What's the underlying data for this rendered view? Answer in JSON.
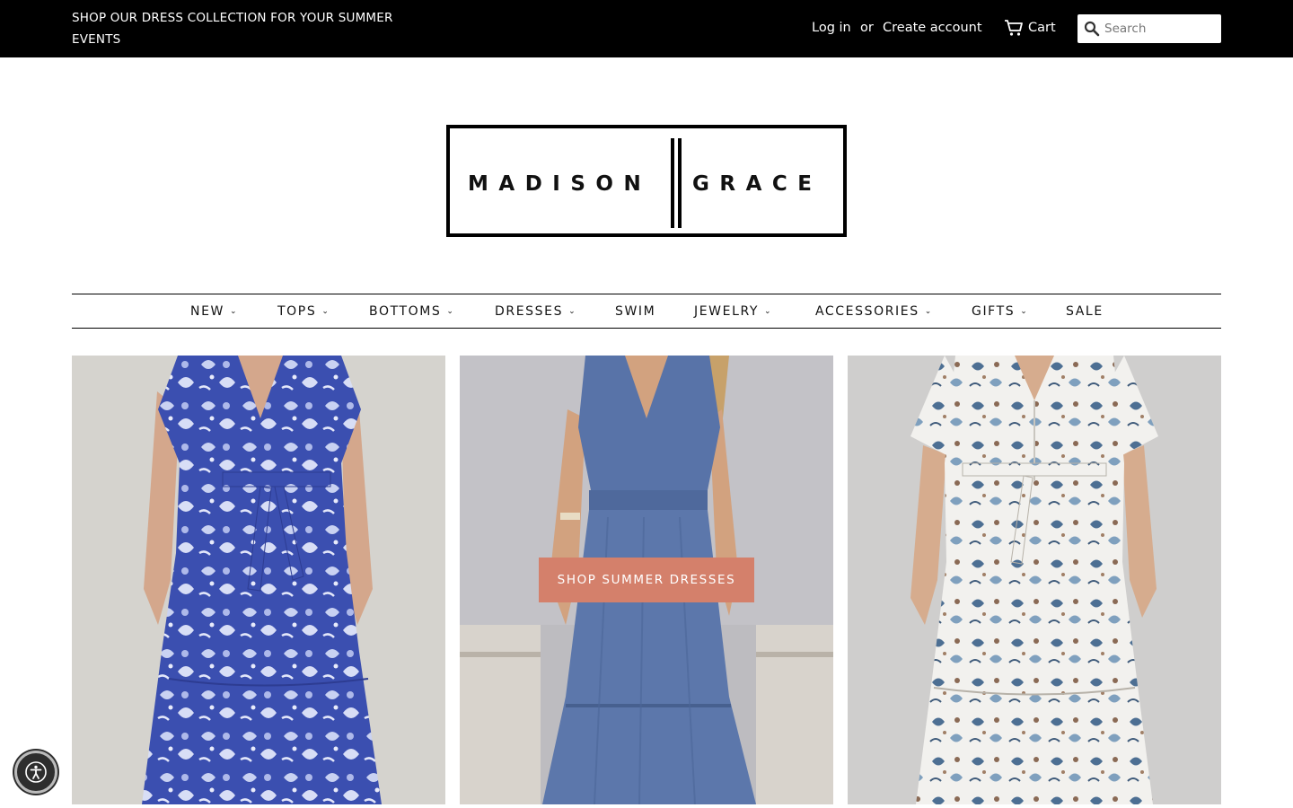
{
  "announcement": {
    "line1": "SHOP OUR DRESS COLLECTION FOR YOUR SUMMER",
    "line2": "EVENTS"
  },
  "account": {
    "login_label": "Log in",
    "separator": "or",
    "create_label": "Create account"
  },
  "cart": {
    "label": "Cart",
    "icon": "cart-icon"
  },
  "search": {
    "placeholder": "Search",
    "icon": "search-icon"
  },
  "logo": {
    "left_word": "MADISON",
    "right_word": "GRACE"
  },
  "nav": {
    "items": [
      {
        "label": "NEW",
        "dropdown": true
      },
      {
        "label": "TOPS",
        "dropdown": true
      },
      {
        "label": "BOTTOMS",
        "dropdown": true
      },
      {
        "label": "DRESSES",
        "dropdown": true
      },
      {
        "label": "SWIM",
        "dropdown": false
      },
      {
        "label": "JEWELRY",
        "dropdown": true
      },
      {
        "label": "ACCESSORIES",
        "dropdown": true
      },
      {
        "label": "GIFTS",
        "dropdown": true
      },
      {
        "label": "SALE",
        "dropdown": false
      }
    ]
  },
  "hero": {
    "cta_label": "SHOP SUMMER DRESSES",
    "cta_color": "#d4806b"
  },
  "accessibility": {
    "icon": "accessibility-icon"
  }
}
